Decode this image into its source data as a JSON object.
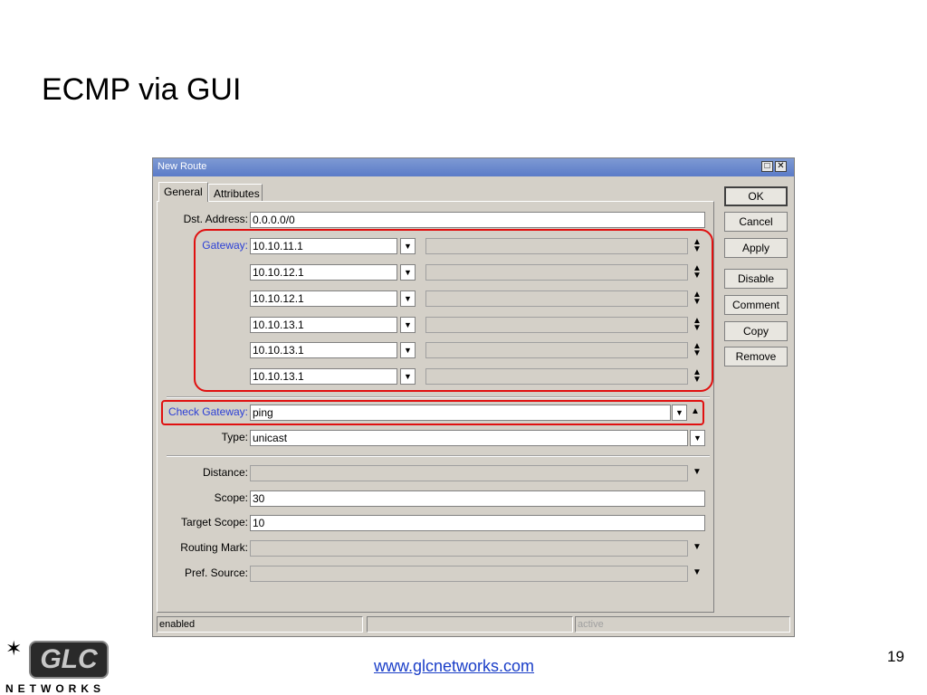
{
  "slide": {
    "title": "ECMP via GUI",
    "footer_url": "www.glcnetworks.com",
    "page_number": "19",
    "logo_text": "GLC",
    "logo_subtext": "NETWORKS"
  },
  "window": {
    "title": "New Route",
    "tabs": [
      "General",
      "Attributes"
    ],
    "fields": {
      "dst_address": {
        "label": "Dst. Address:",
        "value": "0.0.0.0/0"
      },
      "gateway": {
        "label": "Gateway:",
        "values": [
          "10.10.11.1",
          "10.10.12.1",
          "10.10.12.1",
          "10.10.13.1",
          "10.10.13.1",
          "10.10.13.1"
        ]
      },
      "check_gateway": {
        "label": "Check Gateway:",
        "value": "ping"
      },
      "type": {
        "label": "Type:",
        "value": "unicast"
      },
      "distance": {
        "label": "Distance:",
        "value": ""
      },
      "scope": {
        "label": "Scope:",
        "value": "30"
      },
      "target_scope": {
        "label": "Target Scope:",
        "value": "10"
      },
      "routing_mark": {
        "label": "Routing Mark:",
        "value": ""
      },
      "pref_source": {
        "label": "Pref. Source:",
        "value": ""
      }
    },
    "buttons": [
      "OK",
      "Cancel",
      "Apply",
      "Disable",
      "Comment",
      "Copy",
      "Remove"
    ],
    "status": {
      "left": "enabled",
      "middle": "",
      "right": "active"
    }
  },
  "colors": {
    "highlight": "#e01010",
    "label_blue": "#2b3fd6",
    "link": "#1a3ec8"
  }
}
